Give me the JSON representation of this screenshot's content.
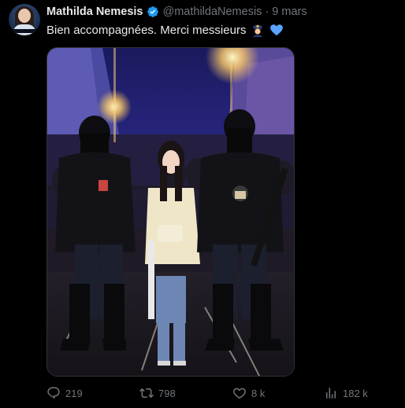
{
  "author": {
    "name": "Mathilda Nemesis",
    "handle": "@mathildaNemesis",
    "separator": "·",
    "date": "9 mars"
  },
  "tweet": {
    "text": "Bien accompagnées. Merci messieurs"
  },
  "icons": {
    "verified": "verified-badge-icon",
    "police_emoji": "police-officer-emoji",
    "heart_emoji": "blue-heart-emoji",
    "reply": "reply-icon",
    "retweet": "retweet-icon",
    "like": "like-icon",
    "views": "views-icon"
  },
  "stats": {
    "replies": "219",
    "retweets": "798",
    "likes": "8 k",
    "views": "182 k"
  },
  "colors": {
    "background": "#000000",
    "text": "#e7e9ea",
    "muted": "#71767b",
    "verified": "#1d9bf0",
    "heart": "#5aa3ff"
  }
}
